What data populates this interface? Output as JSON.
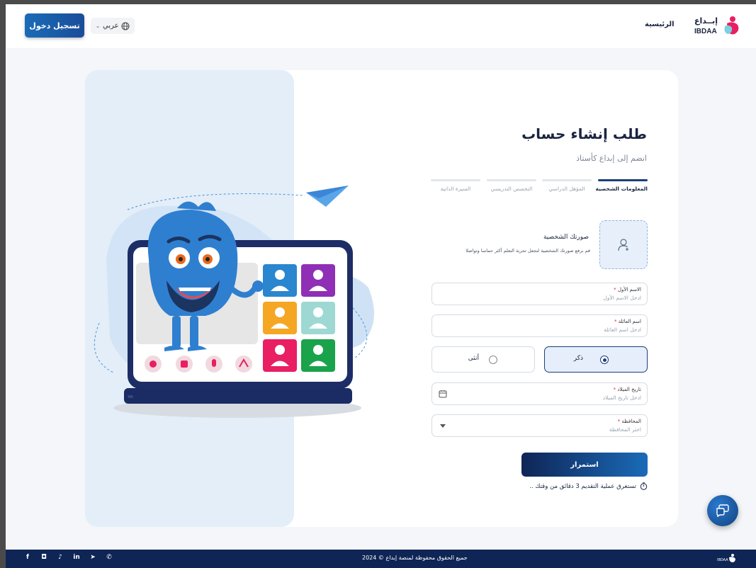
{
  "header": {
    "login_label": "تسجيل دخول",
    "lang_label": "عربي",
    "home_label": "الرئيسية",
    "logo_ar": "إبــداع",
    "logo_en": "IBDAA"
  },
  "form": {
    "title": "طلب إنشاء حساب",
    "subtitle": "انضم إلى إبداع كأستاذ",
    "steps": [
      {
        "label": "المعلومات الشخصية",
        "active": true
      },
      {
        "label": "المؤهل الدراسي",
        "active": false
      },
      {
        "label": "التخصص التدريسي",
        "active": false
      },
      {
        "label": "السيرة الذاتية",
        "active": false
      }
    ],
    "photo_title": "صورتك الشخصية",
    "photo_desc": "قم برفع صورتك الشخصية لتجعل تجربة التعلم أكثر حماسا وتواصلا",
    "first_name": {
      "label": "الاسم الأول",
      "placeholder": "ادخل الاسم الأول"
    },
    "last_name": {
      "label": "اسم العائلة",
      "placeholder": "ادخل اسم العائلة"
    },
    "gender": {
      "male": "ذكر",
      "female": "أنثى",
      "selected": "male"
    },
    "birth_date": {
      "label": "تاريخ الميلاد",
      "placeholder": "ادخل تاريخ الميلاد"
    },
    "governorate": {
      "label": "المحافظة",
      "placeholder": "اختر المحافظة"
    },
    "required_mark": "*",
    "continue_label": "استمرار",
    "time_note": "تستغرق عملية التقديم 3 دقائق من وقتك .."
  },
  "footer": {
    "copyright": "جميع الحقوق محفوظة لمنصة إبداع © 2024",
    "social_icons": [
      "facebook-icon",
      "instagram-icon",
      "tiktok-icon",
      "linkedin-icon",
      "telegram-icon",
      "whatsapp-icon"
    ],
    "logo_en": "IBDAA"
  },
  "colors": {
    "primary": "#1b3f7a",
    "accent_pink": "#e91e63",
    "footer_bg": "#0f2556"
  }
}
